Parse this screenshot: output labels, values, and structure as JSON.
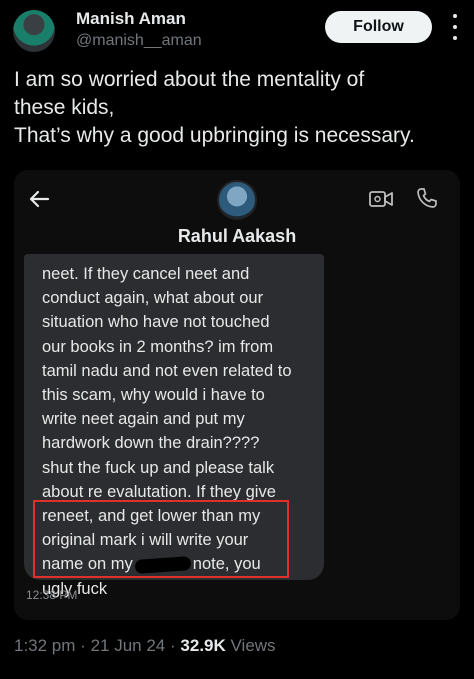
{
  "header": {
    "display_name": "Manish Aman",
    "handle": "@manish__aman",
    "follow_label": "Follow"
  },
  "tweet": {
    "lines": [
      "I am so worried about the mentality of",
      "these kids,",
      "That’s why a good upbringing is necessary."
    ]
  },
  "screenshot": {
    "contact_name": "Rahul Aakash",
    "message_lines": [
      "neet. If they cancel neet and",
      "conduct again, what about our",
      "situation who have not touched",
      "our books in 2 months? im from",
      "tamil nadu and not even related to",
      "this scam, why would i have to",
      "write neet again and put my",
      "hardwork down the drain????",
      "shut the fuck up and please talk",
      "about re evalutation. If they give",
      "reneet, and get lower than my",
      "original mark i will write your"
    ],
    "message_line_13_before": "name on my",
    "message_line_13_after": "note, you",
    "message_line_14": "ugly fuck",
    "message_time": "12:38 PM"
  },
  "meta": {
    "time": "1:32 pm",
    "separator": "·",
    "date": "21 Jun 24",
    "views_count": "32.9K",
    "views_label": "Views"
  },
  "colors": {
    "background": "#000000",
    "highlight_border": "#e0302a",
    "bubble": "#2c2d30"
  },
  "icons": [
    "more-icon",
    "back-arrow-icon",
    "video-call-icon",
    "phone-call-icon"
  ]
}
